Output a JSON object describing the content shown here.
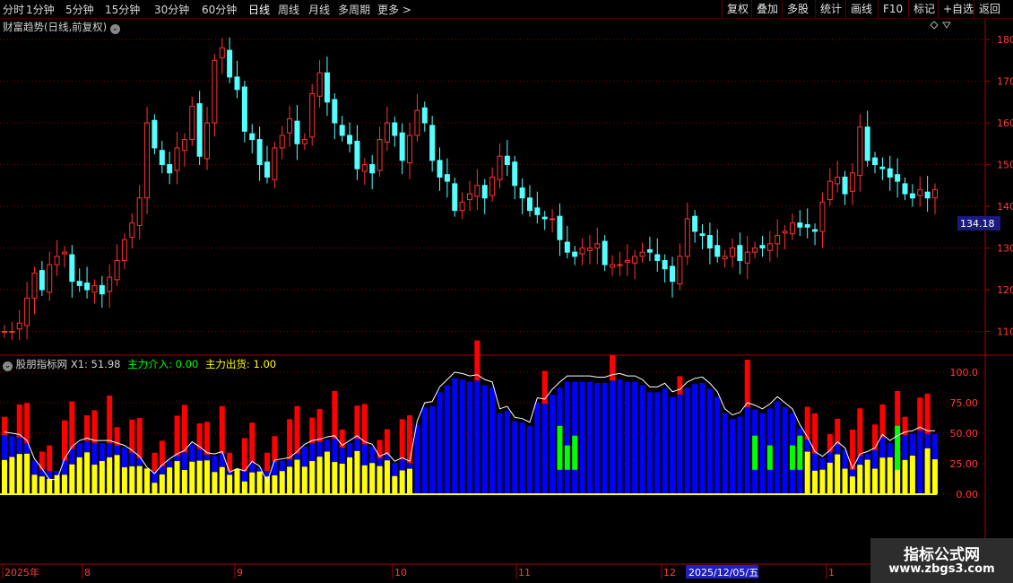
{
  "toolbar": {
    "periods": [
      "分时",
      "1分钟",
      "5分钟",
      "15分钟",
      "30分钟",
      "60分钟",
      "日线",
      "周线",
      "月线",
      "多周期"
    ],
    "active_period": "日线",
    "more": "更多",
    "right_buttons": [
      "复权",
      "叠加",
      "多股",
      "统计",
      "画线",
      "F10",
      "标记",
      "+自选",
      "返回"
    ]
  },
  "main_panel": {
    "title": "财富趋势(日线,前复权)",
    "price_ticks": [
      "180.0",
      "170.0",
      "160.0",
      "150.0",
      "140.0",
      "130.0",
      "120.0",
      "110.0"
    ],
    "current_price_label": "134.18"
  },
  "indicator_panel": {
    "name": "股朋指标网",
    "x1_label": "X1:",
    "x1_value": "51.98",
    "inflow_label": "主力介入:",
    "inflow_value": "0.00",
    "outflow_label": "主力出货:",
    "outflow_value": "1.00",
    "ticks": [
      "100.0",
      "75.00",
      "50.00",
      "25.00",
      "0.00"
    ]
  },
  "time_axis": {
    "labels": [
      "2025年",
      "8",
      "9",
      "10",
      "11",
      "12",
      "1"
    ],
    "cursor_date": "2025/12/05/五"
  },
  "watermark": {
    "line1": "指标公式网",
    "line2": "www.zbgs3.com"
  },
  "colors": {
    "up": "#ff3232",
    "down": "#54ffff",
    "blue_bar": "#0000ff",
    "red_bar": "#ff0000",
    "yellow_bar": "#ffff00",
    "green_bar": "#00ff00",
    "x1_line": "#ffffff",
    "grid": "#8b0000"
  },
  "chart_data": [
    {
      "type": "candlestick",
      "title": "财富趋势(日线,前复权)",
      "y_ticks": [
        110,
        120,
        130,
        140,
        150,
        160,
        170,
        180
      ],
      "ylim": [
        106,
        184
      ],
      "x_labels": [
        "2025年",
        "8",
        "9",
        "10",
        "11",
        "12",
        "1"
      ],
      "last_price": 134.18,
      "series": [
        {
          "name": "财富趋势",
          "ohlc_close": [
            110,
            110,
            112,
            118,
            124,
            120,
            126,
            128,
            129,
            122,
            121,
            120,
            121,
            119,
            123,
            127,
            132,
            136,
            142,
            160,
            154,
            150,
            148,
            154,
            156,
            164,
            152,
            160,
            175,
            178,
            171,
            168,
            158,
            156,
            150,
            147,
            154,
            157,
            161,
            155,
            156,
            167,
            172,
            165,
            160,
            157,
            155,
            149,
            150,
            148,
            156,
            160,
            157,
            151,
            157,
            163,
            160,
            151,
            147,
            146,
            139,
            141,
            143,
            145,
            142,
            147,
            152,
            150,
            145,
            142,
            139,
            138,
            137,
            137,
            132,
            129,
            128,
            130,
            130,
            131,
            126,
            126,
            126,
            127,
            128,
            129,
            129,
            127,
            125,
            122,
            128,
            137,
            134,
            133,
            130,
            128,
            128,
            130,
            127,
            129,
            130,
            130,
            131,
            133,
            134,
            136,
            135,
            135,
            134,
            141,
            146,
            147,
            143,
            148,
            159,
            151,
            150,
            149,
            147,
            146,
            143,
            142,
            144,
            142,
            144
          ]
        }
      ]
    },
    {
      "type": "bar",
      "title": "股朋指标网",
      "ylim": [
        0,
        100
      ],
      "y_ticks": [
        0,
        25,
        50,
        75,
        100
      ],
      "series": [
        {
          "name": "X1",
          "values": [
            51,
            50,
            49,
            44,
            29,
            21,
            12,
            12,
            29,
            39,
            44,
            46,
            44,
            44,
            44,
            42,
            40,
            36,
            31,
            22,
            17,
            24,
            29,
            33,
            36,
            43,
            39,
            34,
            33,
            35,
            18,
            21,
            19,
            27,
            23,
            10,
            28,
            29,
            30,
            35,
            41,
            44,
            45,
            47,
            48,
            40,
            44,
            48,
            43,
            41,
            31,
            34,
            27,
            30,
            27,
            60,
            75,
            76,
            88,
            94,
            100,
            99,
            97,
            98,
            94,
            92,
            70,
            72,
            63,
            62,
            59,
            79,
            78,
            86,
            92,
            97,
            97,
            97,
            97,
            96,
            96,
            98,
            99,
            97,
            97,
            94,
            88,
            88,
            91,
            84,
            86,
            92,
            95,
            96,
            91,
            84,
            70,
            65,
            67,
            75,
            73,
            70,
            74,
            80,
            75,
            70,
            57,
            47,
            35,
            31,
            36,
            43,
            38,
            21,
            33,
            35,
            38,
            49,
            44,
            48,
            51,
            52,
            55,
            52,
            52
          ]
        },
        {
          "name": "主力介入",
          "values": [
            0,
            0,
            0,
            0,
            0,
            0,
            0,
            0,
            0,
            0,
            0,
            0,
            0,
            0,
            0,
            0,
            0,
            0,
            0,
            0,
            0,
            0,
            0,
            0,
            0,
            0,
            0,
            0,
            0,
            0,
            0,
            0,
            0,
            0,
            0,
            0,
            0,
            0,
            0,
            0,
            0,
            0,
            0,
            0,
            0,
            0,
            0,
            0,
            0,
            0,
            0,
            0,
            0,
            0,
            0,
            0,
            0,
            0,
            0,
            0,
            0,
            0,
            0,
            0,
            0,
            0,
            0,
            0,
            0,
            0,
            0,
            0,
            0,
            0,
            0,
            0,
            0,
            0,
            0,
            0,
            0,
            0,
            0,
            0,
            0,
            0,
            0,
            0,
            0,
            0,
            0,
            0,
            0,
            0,
            0,
            0,
            0,
            0,
            0,
            0,
            0,
            0,
            0,
            0,
            0,
            0,
            0,
            0,
            0,
            0,
            0,
            0,
            0,
            0,
            0,
            0,
            0,
            0,
            0,
            0,
            0,
            0,
            0,
            0,
            0
          ]
        },
        {
          "name": "主力出货",
          "values": [
            1,
            1,
            1,
            1,
            1,
            1,
            1,
            1,
            1,
            1,
            1,
            1,
            1,
            1,
            1,
            1,
            1,
            1,
            1,
            1,
            1,
            1,
            1,
            1,
            1,
            1,
            1,
            1,
            1,
            1,
            1,
            1,
            1,
            1,
            1,
            1,
            1,
            1,
            1,
            1,
            1,
            1,
            1,
            1,
            1,
            1,
            1,
            1,
            1,
            1,
            1,
            1,
            1,
            1,
            1,
            1,
            1,
            1,
            1,
            1,
            1,
            1,
            1,
            1,
            1,
            1,
            1,
            1,
            1,
            1,
            1,
            1,
            1,
            1,
            1,
            1,
            1,
            1,
            1,
            1,
            1,
            1,
            1,
            1,
            1,
            1,
            1,
            1,
            1,
            1,
            1,
            1,
            1,
            1,
            1,
            1,
            1,
            1,
            1,
            1,
            1,
            1,
            1,
            1,
            1,
            1,
            1,
            1,
            1,
            1,
            1,
            1,
            1,
            1,
            1,
            1,
            1,
            1,
            1,
            1,
            1,
            1,
            1,
            1,
            1
          ]
        }
      ]
    }
  ]
}
